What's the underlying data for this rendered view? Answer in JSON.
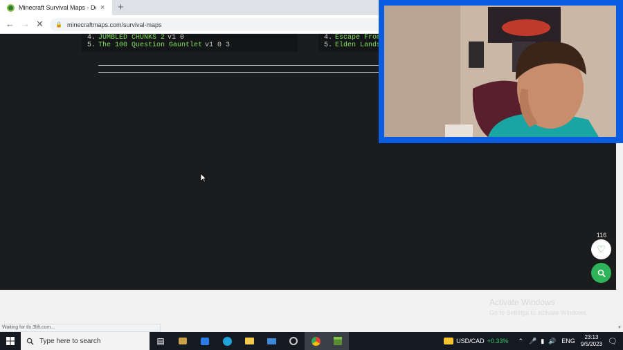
{
  "browser": {
    "tab_title": "Minecraft Survival Maps - Download",
    "tab_close": "×",
    "new_tab": "+",
    "url": "minecraftmaps.com/survival-maps",
    "status": "Waiting for tlx.3lift.com..."
  },
  "page": {
    "list_left": [
      {
        "num": "4.",
        "name": "JUMBLED CHUNKS 2",
        "ver": "v1 0"
      },
      {
        "num": "5.",
        "name": "The 100 Question Gauntlet",
        "ver": "v1 0 3"
      }
    ],
    "list_right": [
      {
        "num": "4.",
        "name": "Escape From"
      },
      {
        "num": "5.",
        "name": "Elden Lands v"
      }
    ],
    "like_count": "116"
  },
  "watermark": {
    "title": "Activate Windows",
    "subtitle": "Go to Settings to activate Windows."
  },
  "taskbar": {
    "search_placeholder": "Type here to search",
    "ticker_pair": "USD/CAD",
    "ticker_change": "+0.33%",
    "language": "ENG",
    "time": "23:13",
    "date": "9/5/2023"
  },
  "colors": {
    "page_bg": "#1b1c1e",
    "accent_green": "#2fb35a",
    "webcam_border": "#0a5de0"
  }
}
